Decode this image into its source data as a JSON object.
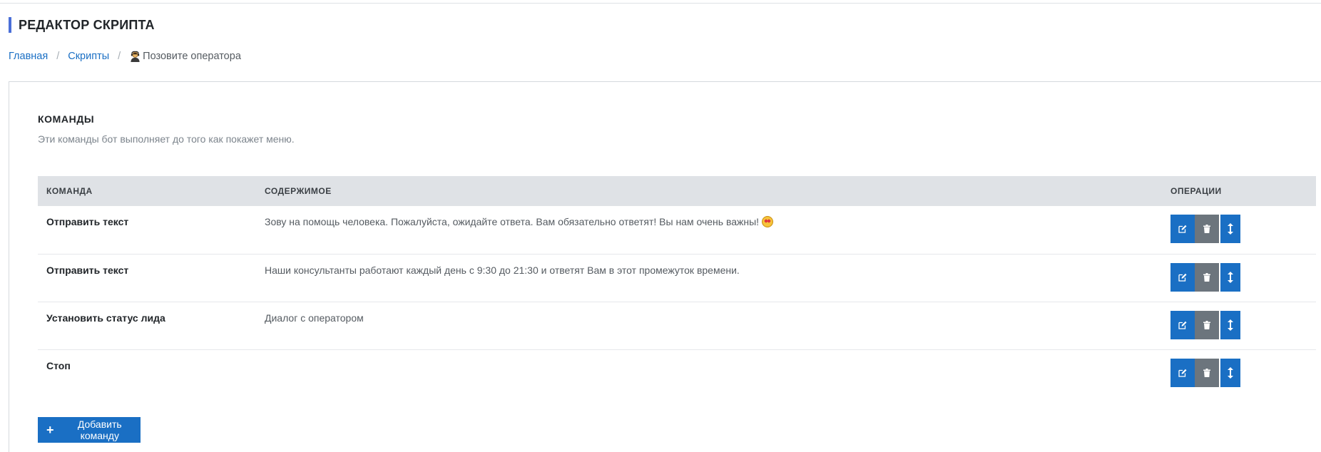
{
  "page": {
    "title": "РЕДАКТОР СКРИПТА"
  },
  "breadcrumb": {
    "home": "Главная",
    "scripts": "Скрипты",
    "current": "Позовите оператора",
    "current_icon": "operator-person-icon"
  },
  "section": {
    "title": "КОМАНДЫ",
    "description": "Эти команды бот выполняет до того как покажет меню."
  },
  "table": {
    "headers": {
      "command": "КОМАНДА",
      "content": "СОДЕРЖИМОЕ",
      "operations": "ОПЕРАЦИИ"
    },
    "rows": [
      {
        "command": "Отправить текст",
        "content": "Зову на помощь человека. Пожалуйста, ожидайте ответа. Вам обязательно ответят! Вы нам очень важны!",
        "emoji": "star-struck-emoji"
      },
      {
        "command": "Отправить текст",
        "content": "Наши консультанты работают каждый день с 9:30 до 21:30 и ответят Вам в этот промежуток времени."
      },
      {
        "command": "Установить статус лида",
        "content": "Диалог с оператором"
      },
      {
        "command": "Стоп",
        "content": ""
      }
    ]
  },
  "actions": {
    "add_command": "Добавить команду"
  },
  "icons": {
    "edit": "edit-icon",
    "delete": "trash-icon",
    "move": "vertical-arrows-icon"
  },
  "colors": {
    "accent": "#4a6fd8",
    "primary_button": "#1a6fc4",
    "secondary_button": "#6c757d",
    "table_header_bg": "#dfe2e6",
    "link": "#1a6fc4"
  }
}
